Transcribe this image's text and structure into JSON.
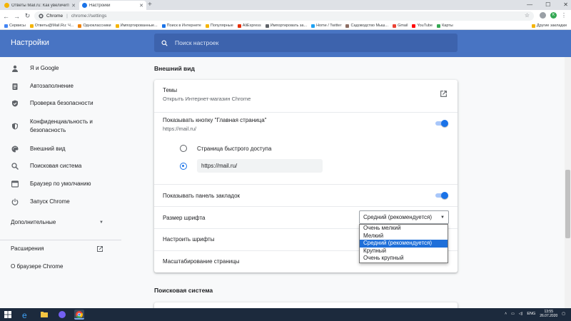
{
  "browser": {
    "tabs": [
      {
        "label": "Ответы Mail.ru: Как увеличить ш...",
        "active": false
      },
      {
        "label": "Настройки",
        "active": true
      }
    ],
    "omnibox": {
      "site": "Chrome",
      "url": "chrome://settings"
    },
    "bookmarks": [
      {
        "label": "Сервисы",
        "color": "#4285f4"
      },
      {
        "label": "Ответы@Mail.Ru: Ч...",
        "color": "#f4b400"
      },
      {
        "label": "Одноклассники",
        "color": "#ee8208"
      },
      {
        "label": "Импортированные...",
        "color": "#f4b400"
      },
      {
        "label": "Поиск в Интернете",
        "color": "#1a73e8"
      },
      {
        "label": "Популярные",
        "color": "#f4b400"
      },
      {
        "label": "AliExpress",
        "color": "#e62e04"
      },
      {
        "label": "Импортировать за...",
        "color": "#5f6368"
      },
      {
        "label": "Home / Twitter",
        "color": "#1da1f2"
      },
      {
        "label": "Садоводство Мыш...",
        "color": "#8d6e63"
      },
      {
        "label": "Gmail",
        "color": "#ea4335"
      },
      {
        "label": "YouTube",
        "color": "#ff0000"
      },
      {
        "label": "Карты",
        "color": "#34a853"
      }
    ],
    "other_bookmarks": "Другие закладки",
    "avatar_letter": "K"
  },
  "header": {
    "title": "Настройки",
    "search_placeholder": "Поиск настроек"
  },
  "sidebar": {
    "items": [
      {
        "label": "Я и Google",
        "icon": "person-icon"
      },
      {
        "label": "Автозаполнение",
        "icon": "clipboard-icon"
      },
      {
        "label": "Проверка безопасности",
        "icon": "shield-check-icon"
      },
      {
        "label": "Конфиденциальность и безопасность",
        "icon": "shield-icon"
      },
      {
        "label": "Внешний вид",
        "icon": "palette-icon"
      },
      {
        "label": "Поисковая система",
        "icon": "search-icon"
      },
      {
        "label": "Браузер по умолчанию",
        "icon": "browser-icon"
      },
      {
        "label": "Запуск Chrome",
        "icon": "power-icon"
      }
    ],
    "advanced": "Дополнительные",
    "extensions": "Расширения",
    "about": "О браузере Chrome"
  },
  "main": {
    "appearance_title": "Внешний вид",
    "themes": {
      "label": "Темы",
      "sublabel": "Открыть Интернет-магазин Chrome"
    },
    "home_button": {
      "label": "Показывать кнопку \"Главная страница\"",
      "sublabel": "https://mail.ru/",
      "enabled": true
    },
    "home_options": {
      "new_tab": "Страница быстрого доступа",
      "custom_url": "https://mail.ru/",
      "selected": "custom"
    },
    "bookmarks_bar": {
      "label": "Показывать панель закладок",
      "enabled": true
    },
    "font_size": {
      "label": "Размер шрифта",
      "value": "Средний (рекомендуется)",
      "options": [
        "Очень мелкий",
        "Мелкий",
        "Средний (рекомендуется)",
        "Крупный",
        "Очень крупный"
      ],
      "selected_index": 2
    },
    "customize_fonts": "Настроить шрифты",
    "page_zoom": "Масштабирование страницы",
    "search_engine_title": "Поисковая система"
  },
  "taskbar": {
    "time": "13:55",
    "date": "26.07.2020",
    "lang": "ENG"
  },
  "colors": {
    "header_blue": "#4874c3",
    "accent": "#1a73e8",
    "taskbar": "#1c2a3d"
  }
}
